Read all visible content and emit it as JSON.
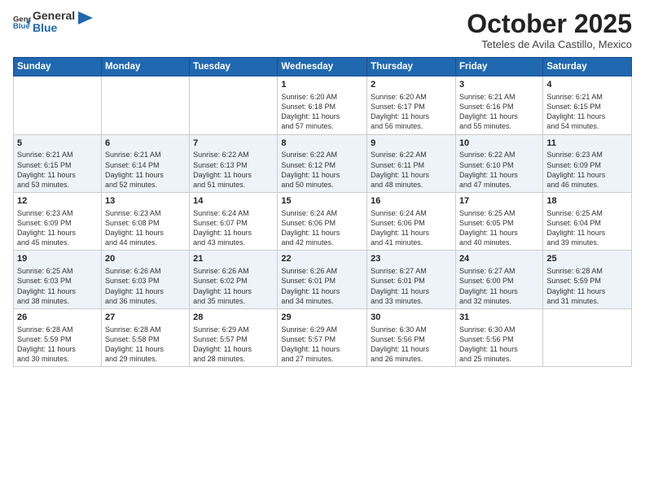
{
  "header": {
    "logo_general": "General",
    "logo_blue": "Blue",
    "month_title": "October 2025",
    "subtitle": "Teteles de Avila Castillo, Mexico"
  },
  "weekdays": [
    "Sunday",
    "Monday",
    "Tuesday",
    "Wednesday",
    "Thursday",
    "Friday",
    "Saturday"
  ],
  "weeks": [
    [
      {
        "day": "",
        "info": ""
      },
      {
        "day": "",
        "info": ""
      },
      {
        "day": "",
        "info": ""
      },
      {
        "day": "1",
        "info": "Sunrise: 6:20 AM\nSunset: 6:18 PM\nDaylight: 11 hours\nand 57 minutes."
      },
      {
        "day": "2",
        "info": "Sunrise: 6:20 AM\nSunset: 6:17 PM\nDaylight: 11 hours\nand 56 minutes."
      },
      {
        "day": "3",
        "info": "Sunrise: 6:21 AM\nSunset: 6:16 PM\nDaylight: 11 hours\nand 55 minutes."
      },
      {
        "day": "4",
        "info": "Sunrise: 6:21 AM\nSunset: 6:15 PM\nDaylight: 11 hours\nand 54 minutes."
      }
    ],
    [
      {
        "day": "5",
        "info": "Sunrise: 6:21 AM\nSunset: 6:15 PM\nDaylight: 11 hours\nand 53 minutes."
      },
      {
        "day": "6",
        "info": "Sunrise: 6:21 AM\nSunset: 6:14 PM\nDaylight: 11 hours\nand 52 minutes."
      },
      {
        "day": "7",
        "info": "Sunrise: 6:22 AM\nSunset: 6:13 PM\nDaylight: 11 hours\nand 51 minutes."
      },
      {
        "day": "8",
        "info": "Sunrise: 6:22 AM\nSunset: 6:12 PM\nDaylight: 11 hours\nand 50 minutes."
      },
      {
        "day": "9",
        "info": "Sunrise: 6:22 AM\nSunset: 6:11 PM\nDaylight: 11 hours\nand 48 minutes."
      },
      {
        "day": "10",
        "info": "Sunrise: 6:22 AM\nSunset: 6:10 PM\nDaylight: 11 hours\nand 47 minutes."
      },
      {
        "day": "11",
        "info": "Sunrise: 6:23 AM\nSunset: 6:09 PM\nDaylight: 11 hours\nand 46 minutes."
      }
    ],
    [
      {
        "day": "12",
        "info": "Sunrise: 6:23 AM\nSunset: 6:09 PM\nDaylight: 11 hours\nand 45 minutes."
      },
      {
        "day": "13",
        "info": "Sunrise: 6:23 AM\nSunset: 6:08 PM\nDaylight: 11 hours\nand 44 minutes."
      },
      {
        "day": "14",
        "info": "Sunrise: 6:24 AM\nSunset: 6:07 PM\nDaylight: 11 hours\nand 43 minutes."
      },
      {
        "day": "15",
        "info": "Sunrise: 6:24 AM\nSunset: 6:06 PM\nDaylight: 11 hours\nand 42 minutes."
      },
      {
        "day": "16",
        "info": "Sunrise: 6:24 AM\nSunset: 6:06 PM\nDaylight: 11 hours\nand 41 minutes."
      },
      {
        "day": "17",
        "info": "Sunrise: 6:25 AM\nSunset: 6:05 PM\nDaylight: 11 hours\nand 40 minutes."
      },
      {
        "day": "18",
        "info": "Sunrise: 6:25 AM\nSunset: 6:04 PM\nDaylight: 11 hours\nand 39 minutes."
      }
    ],
    [
      {
        "day": "19",
        "info": "Sunrise: 6:25 AM\nSunset: 6:03 PM\nDaylight: 11 hours\nand 38 minutes."
      },
      {
        "day": "20",
        "info": "Sunrise: 6:26 AM\nSunset: 6:03 PM\nDaylight: 11 hours\nand 36 minutes."
      },
      {
        "day": "21",
        "info": "Sunrise: 6:26 AM\nSunset: 6:02 PM\nDaylight: 11 hours\nand 35 minutes."
      },
      {
        "day": "22",
        "info": "Sunrise: 6:26 AM\nSunset: 6:01 PM\nDaylight: 11 hours\nand 34 minutes."
      },
      {
        "day": "23",
        "info": "Sunrise: 6:27 AM\nSunset: 6:01 PM\nDaylight: 11 hours\nand 33 minutes."
      },
      {
        "day": "24",
        "info": "Sunrise: 6:27 AM\nSunset: 6:00 PM\nDaylight: 11 hours\nand 32 minutes."
      },
      {
        "day": "25",
        "info": "Sunrise: 6:28 AM\nSunset: 5:59 PM\nDaylight: 11 hours\nand 31 minutes."
      }
    ],
    [
      {
        "day": "26",
        "info": "Sunrise: 6:28 AM\nSunset: 5:59 PM\nDaylight: 11 hours\nand 30 minutes."
      },
      {
        "day": "27",
        "info": "Sunrise: 6:28 AM\nSunset: 5:58 PM\nDaylight: 11 hours\nand 29 minutes."
      },
      {
        "day": "28",
        "info": "Sunrise: 6:29 AM\nSunset: 5:57 PM\nDaylight: 11 hours\nand 28 minutes."
      },
      {
        "day": "29",
        "info": "Sunrise: 6:29 AM\nSunset: 5:57 PM\nDaylight: 11 hours\nand 27 minutes."
      },
      {
        "day": "30",
        "info": "Sunrise: 6:30 AM\nSunset: 5:56 PM\nDaylight: 11 hours\nand 26 minutes."
      },
      {
        "day": "31",
        "info": "Sunrise: 6:30 AM\nSunset: 5:56 PM\nDaylight: 11 hours\nand 25 minutes."
      },
      {
        "day": "",
        "info": ""
      }
    ]
  ]
}
